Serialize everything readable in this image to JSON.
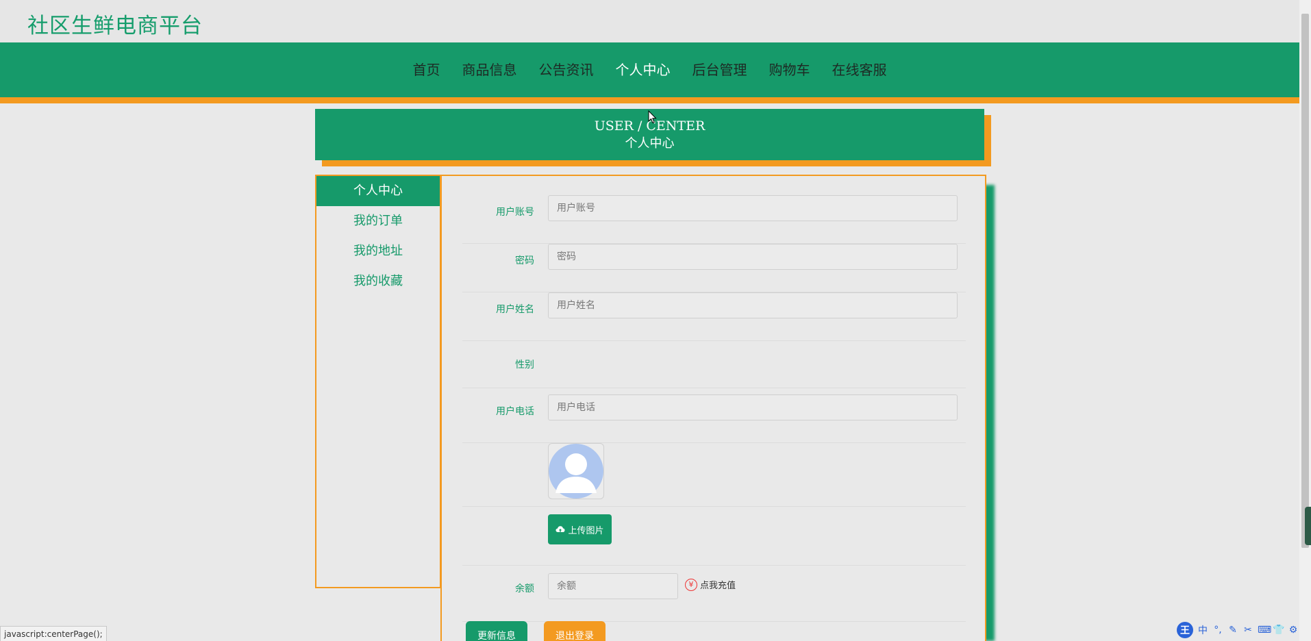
{
  "site": {
    "title": "社区生鲜电商平台"
  },
  "nav": {
    "items": [
      {
        "label": "首页",
        "name": "nav-home"
      },
      {
        "label": "商品信息",
        "name": "nav-products"
      },
      {
        "label": "公告资讯",
        "name": "nav-news"
      },
      {
        "label": "个人中心",
        "name": "nav-user-center",
        "active": true
      },
      {
        "label": "后台管理",
        "name": "nav-admin"
      },
      {
        "label": "购物车",
        "name": "nav-cart"
      },
      {
        "label": "在线客服",
        "name": "nav-support"
      }
    ]
  },
  "banner": {
    "en": "USER / CENTER",
    "cn": "个人中心"
  },
  "side_menu": {
    "items": [
      {
        "label": "个人中心",
        "active": true
      },
      {
        "label": "我的订单"
      },
      {
        "label": "我的地址"
      },
      {
        "label": "我的收藏"
      }
    ]
  },
  "form": {
    "account": {
      "label": "用户账号",
      "placeholder": "用户账号",
      "value": ""
    },
    "password": {
      "label": "密码",
      "placeholder": "密码",
      "value": ""
    },
    "name": {
      "label": "用户姓名",
      "placeholder": "用户姓名",
      "value": ""
    },
    "gender": {
      "label": "性别"
    },
    "phone": {
      "label": "用户电话",
      "placeholder": "用户电话",
      "value": ""
    },
    "upload_label": "上传图片",
    "balance": {
      "label": "余额",
      "placeholder": "余额",
      "value": ""
    },
    "recharge_label": "点我充值",
    "recharge_icon": "¥",
    "update_label": "更新信息",
    "logout_label": "退出登录"
  },
  "statusbar": {
    "text": "javascript:centerPage();"
  },
  "ime": {
    "logo": "王",
    "mode": "中",
    "glyphs": [
      "°,",
      "✎",
      "✂",
      "⌨",
      "👕",
      "⚙"
    ]
  },
  "colors": {
    "primary": "#169a6a",
    "accent": "#f39a20",
    "background": "#e9e9e9"
  }
}
